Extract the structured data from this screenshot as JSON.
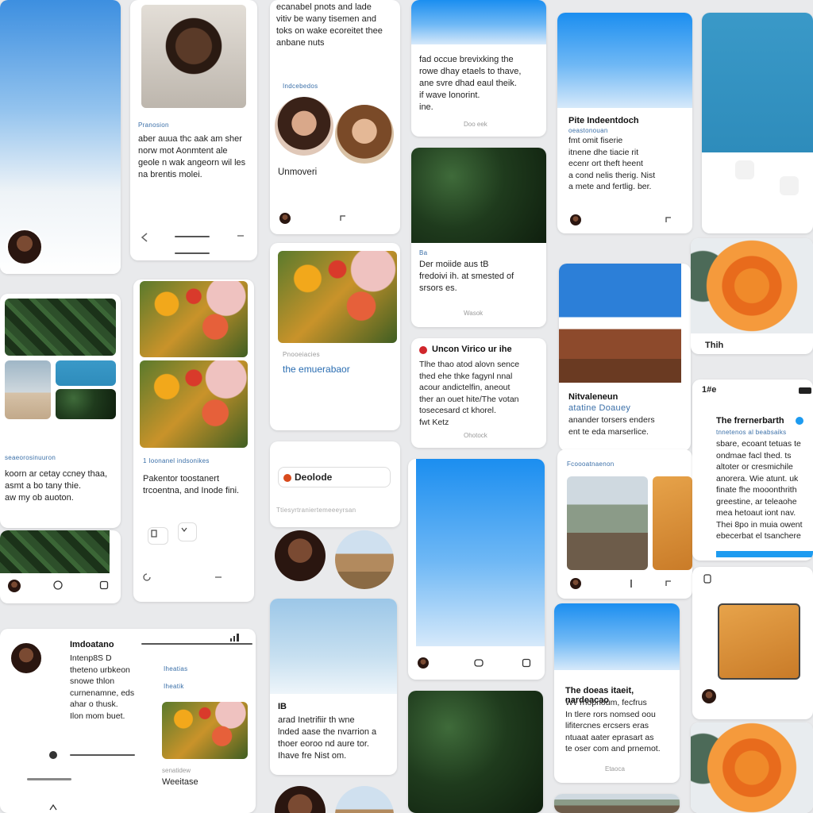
{
  "cards": {
    "c1": {
      "sub": "Pranosion",
      "text": "aber auua thc aak am sher\nnorw mot Aonmtent ale\ngeole n wak angeorn wil les\nna brentis molei."
    },
    "c2": {
      "text": "ecanabel pnots and lade\nvitiv be wany tisemen and\ntoks on wake ecoreitet thee\nanbane nuts",
      "sub": "Indcebedos",
      "name": "Unmoveri"
    },
    "c3": {
      "text": "fad occue brevixking the\nrowe dhay etaels to thave,\nane svre dhad eaul theik.\nif wave lonorint.\nine.",
      "foot": "Doo eek"
    },
    "c4": {
      "title": "Pite Indeentdoch",
      "sub": "oeastonouan",
      "text": "fmt omit fiserie\nitnene dhe tiacie rit\necenr ort theft heent\na cond nelis therig. Nist\na mete and fertlig. ber."
    },
    "c5": {
      "sub": "Ba",
      "text": "Der moiide aus tB\nfredoivi ih. at smested of\nsrsors es.",
      "foot": "Wasok"
    },
    "c6": {
      "sub": "Pnooeiacies",
      "link": "the emuerabaor"
    },
    "c7": {
      "sub": "seaeorosinuuron",
      "text": "koorn ar cetay ccney thaa,\nasmt a bo tany thie.\naw my ob auoton."
    },
    "c8": {
      "sub": "1 Ioonanel indsonikes",
      "text": "Pakentor toostanert\ntrcoentna, and Inode fini."
    },
    "c9": {
      "title": "Uncon Virico ur ihe",
      "text": "Tlhe thao atod alovn sence\nthed ehe thke fagynl nnal\nacour andictelfin, aneout\nther an ouet hite/The votan\ntosecesard ct khorel.\nfwt Ketz",
      "foot": "Ohotock"
    },
    "c10": {
      "title": "Nitvaleneun",
      "sub": "atatine Doauey",
      "text": "anander torsers enders\nent te eda marserlice."
    },
    "c11": {
      "title": "The frernerbarth",
      "sub": "tnnetenos al beabsaiks",
      "text": "sbare, ecoant tetuas te\nondmae facl thed. ts\naltoter or cresmichile\nanorera. Wie atunt. uk\nfinate fhe mooonthrith\ngreestine, ar teleaohe\nmea hetoaut iont nav.\nThei 8po in muia owent\nebecerbat el tsanchere"
    },
    "c12": {
      "label": "Deolode",
      "sub": "Ttiesyrtraniertemeeeyrsan"
    },
    "c13": {
      "sub": "Fcoooatnaenon"
    },
    "c14": {
      "name": "Imdoatano",
      "text": "Intenp8S D\ntheteno urbkeon\nsnowe thlon\ncurnenamne, eds\nahar o thusk.\nIlon mom buet.",
      "sub1": "Iheatias",
      "sub2": "Iheatik",
      "foot": "senatidew",
      "label": "Weeitase"
    },
    "c15": {
      "title": "IB",
      "text": "arad Inetrifiir th wne\nlnded aase the nvarrion a\nthoer eoroo nd aure tor.\nIhave fre Nist om."
    },
    "c16": {
      "title": "The doeas itaeit, nardeacao",
      "text": "Wv rnopnoum, fecfrus\nIn tlere rors nomsed oou\nlifitercnes ercsers eras\nntuaat aater eprasart as\nte oser com and prnemot.",
      "foot": "Etaoca"
    },
    "c17": {
      "label": "Thih"
    },
    "c18": {
      "label": "1#e"
    }
  },
  "colors": {
    "accent": "#1d9bf0",
    "link": "#2a6db1",
    "heart": "#d0262c",
    "bg": "#e9eaec"
  }
}
